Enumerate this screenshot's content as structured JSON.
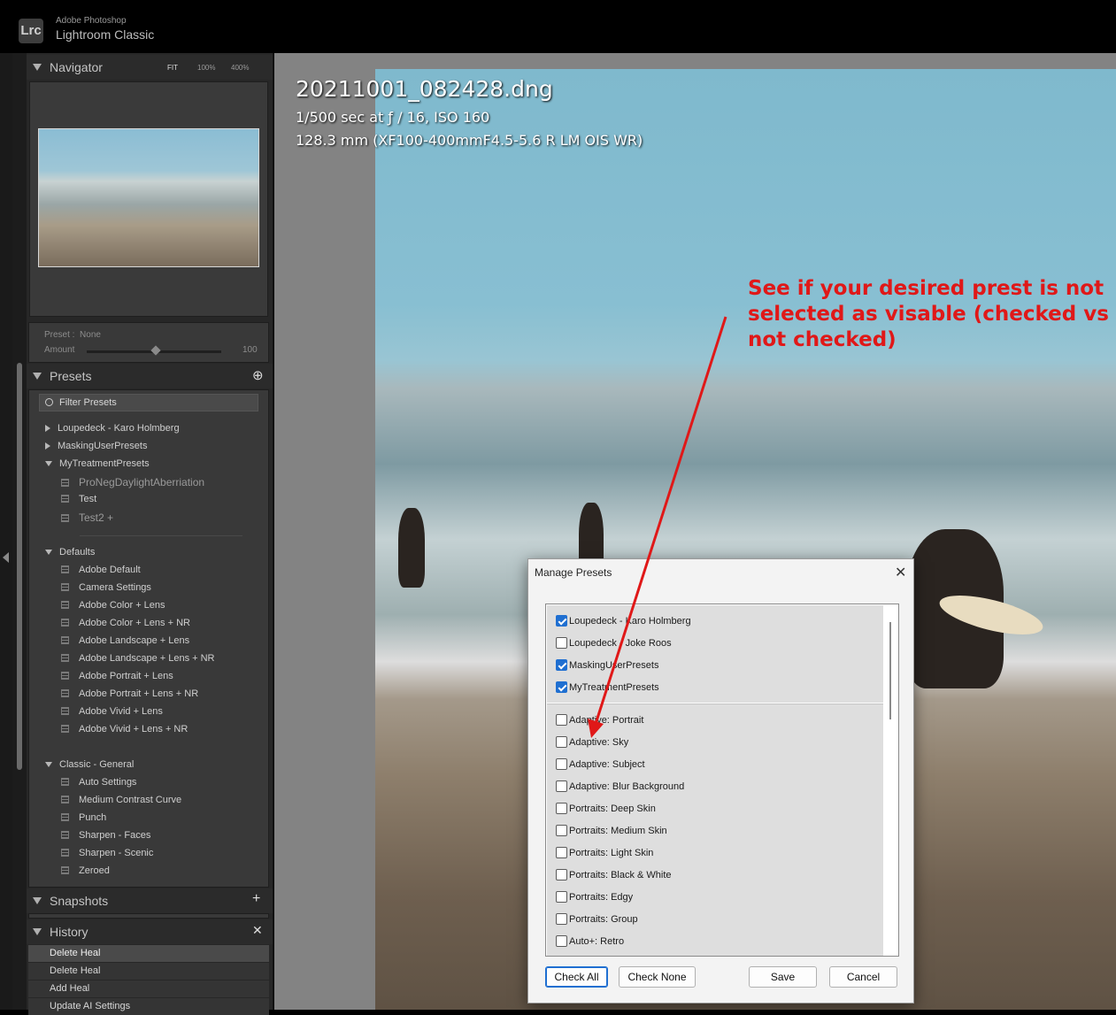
{
  "app": {
    "logo": "Lrc",
    "vendor": "Adobe Photoshop",
    "name": "Lightroom Classic"
  },
  "navigator": {
    "title": "Navigator",
    "zoom": [
      "FIT",
      "100%",
      "400%"
    ]
  },
  "preset_info": {
    "preset_label": "Preset :",
    "preset_value": "None",
    "amount_label": "Amount",
    "amount_value": "100"
  },
  "presets": {
    "title": "Presets",
    "filter_placeholder": "Filter Presets",
    "groups_top": [
      {
        "label": "Loupedeck - Karo Holmberg"
      },
      {
        "label": "MaskingUserPresets"
      },
      {
        "label": "MyTreatmentPresets"
      }
    ],
    "mytreatment_items": [
      "ProNegDaylightAberriation",
      "Test",
      "Test2 +"
    ],
    "defaults_label": "Defaults",
    "defaults_items": [
      "Adobe Default",
      "Camera Settings",
      "Adobe Color + Lens",
      "Adobe Color + Lens + NR",
      "Adobe Landscape + Lens",
      "Adobe Landscape + Lens + NR",
      "Adobe Portrait + Lens",
      "Adobe Portrait + Lens + NR",
      "Adobe Vivid + Lens",
      "Adobe Vivid + Lens + NR"
    ],
    "classic_label": "Classic - General",
    "classic_items": [
      "Auto Settings",
      "Medium Contrast Curve",
      "Punch",
      "Sharpen - Faces",
      "Sharpen - Scenic",
      "Zeroed"
    ]
  },
  "snapshots": {
    "title": "Snapshots"
  },
  "history": {
    "title": "History",
    "items": [
      "Delete Heal",
      "Delete Heal",
      "Add Heal",
      "Update AI Settings"
    ]
  },
  "photo_info": {
    "filename": "20211001_082428.dng",
    "exposure": "1/500 sec at ƒ / 16, ISO 160",
    "lens": "128.3 mm (XF100-400mmF4.5-5.6 R LM OIS WR)"
  },
  "annotation": {
    "lines": [
      "See if your desired prest is not",
      "selected as visable (checked vs",
      "not checked)"
    ],
    "color": "#e01818"
  },
  "dialog": {
    "title": "Manage Presets",
    "user_presets": [
      {
        "label": "Loupedeck - Karo Holmberg",
        "checked": true
      },
      {
        "label": "Loupedeck - Joke Roos",
        "checked": false
      },
      {
        "label": "MaskingUserPresets",
        "checked": true
      },
      {
        "label": "MyTreatmentPresets",
        "checked": true
      }
    ],
    "system_presets": [
      {
        "label": "Adaptive: Portrait",
        "checked": false
      },
      {
        "label": "Adaptive: Sky",
        "checked": false
      },
      {
        "label": "Adaptive: Subject",
        "checked": false
      },
      {
        "label": "Adaptive: Blur Background",
        "checked": false
      },
      {
        "label": "Portraits: Deep Skin",
        "checked": false
      },
      {
        "label": "Portraits: Medium Skin",
        "checked": false
      },
      {
        "label": "Portraits: Light Skin",
        "checked": false
      },
      {
        "label": "Portraits: Black & White",
        "checked": false
      },
      {
        "label": "Portraits: Edgy",
        "checked": false
      },
      {
        "label": "Portraits: Group",
        "checked": false
      },
      {
        "label": "Auto+: Retro",
        "checked": false
      }
    ],
    "buttons": {
      "check_all": "Check All",
      "check_none": "Check None",
      "save": "Save",
      "cancel": "Cancel"
    }
  }
}
